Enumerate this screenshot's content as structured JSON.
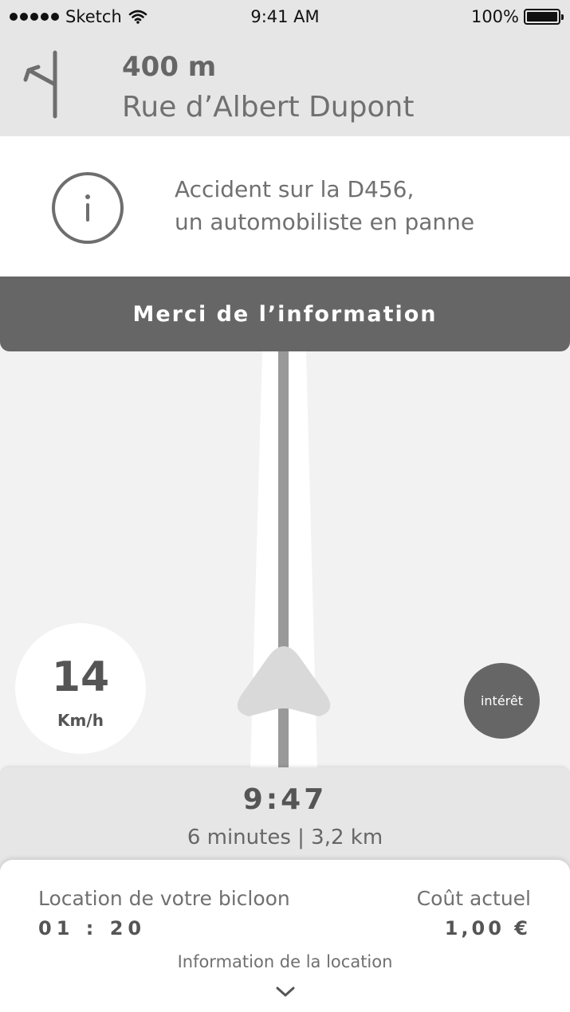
{
  "status_bar": {
    "carrier": "Sketch",
    "time": "9:41 AM",
    "battery_percent": "100%",
    "icons": [
      "signal-dots-icon",
      "wifi-icon",
      "battery-icon"
    ]
  },
  "navigation": {
    "distance": "400 m",
    "street": "Rue d’Albert Dupont",
    "icon": "turn-left-icon"
  },
  "alert": {
    "icon": "info-icon",
    "line1": "Accident sur la D456,",
    "line2": "un automobiliste en panne",
    "thanks_button": "Merci de l’information"
  },
  "map": {
    "speed_value": "14",
    "speed_unit": "Km/h",
    "poi_button": "intérêt",
    "position_icon": "navigation-arrow-icon"
  },
  "eta": {
    "arrival_time": "9:47",
    "summary": "6 minutes | 3,2 km"
  },
  "rental": {
    "label": "Location de votre bicloon",
    "duration": "01 : 20",
    "cost_label": "Coût actuel",
    "cost_value": "1,00 €",
    "info_link": "Information de la location",
    "expand_icon": "chevron-down-icon"
  },
  "colors": {
    "header_bg": "#e6e6e6",
    "button_bg": "#666666",
    "map_bg": "#f2f2f2",
    "route": "#999999"
  }
}
